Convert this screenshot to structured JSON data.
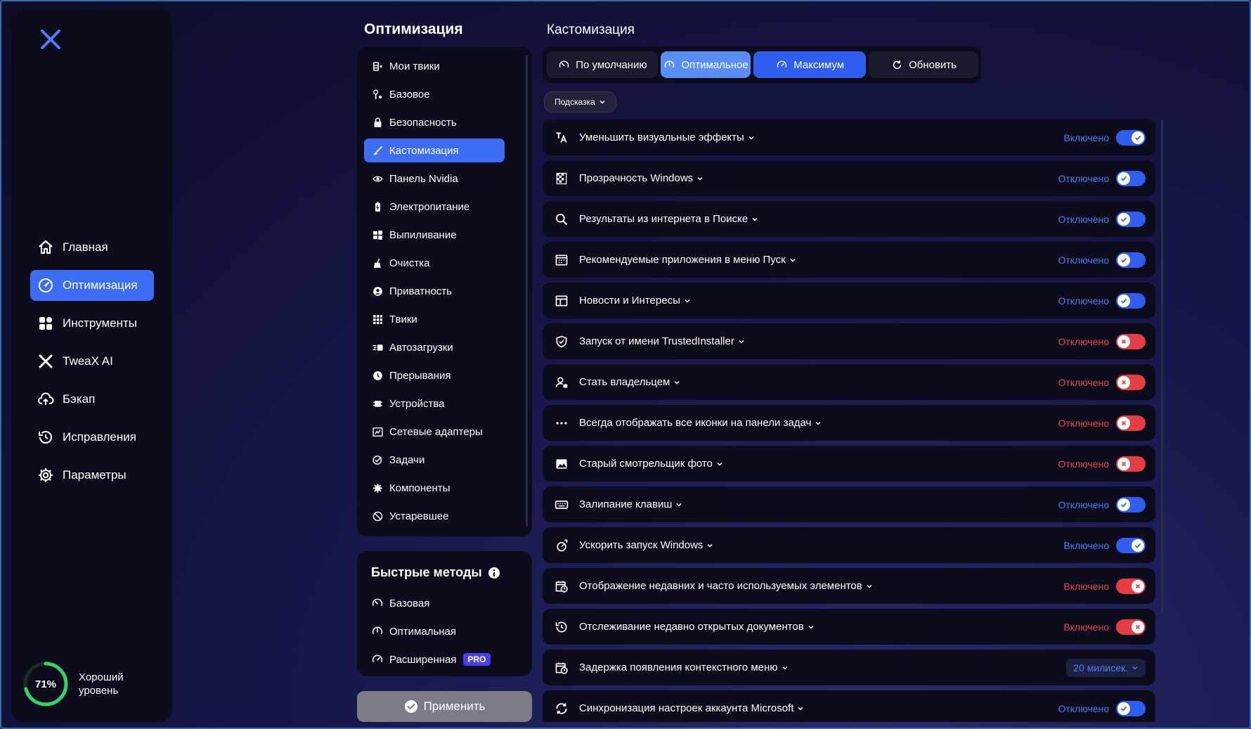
{
  "sidebar": {
    "nav": [
      {
        "label": "Главная",
        "icon": "home-icon"
      },
      {
        "label": "Оптимизация",
        "icon": "gauge-icon",
        "active": true
      },
      {
        "label": "Инструменты",
        "icon": "grid-icon"
      },
      {
        "label": "TweaX AI",
        "icon": "ai-icon"
      },
      {
        "label": "Бэкап",
        "icon": "cloud-upload-icon"
      },
      {
        "label": "Исправления",
        "icon": "history-icon"
      },
      {
        "label": "Параметры",
        "icon": "gear-icon"
      }
    ],
    "health": {
      "percent_label": "71%",
      "percent": 71,
      "label": "Хороший уровень"
    }
  },
  "middle": {
    "title": "Оптимизация",
    "categories": [
      {
        "label": "Мои твики",
        "icon": "my-tweaks-icon"
      },
      {
        "label": "Базовое",
        "icon": "tools-icon"
      },
      {
        "label": "Безопасность",
        "icon": "lock-icon"
      },
      {
        "label": "Кастомизация",
        "icon": "brush-icon",
        "active": true
      },
      {
        "label": "Панель Nvidia",
        "icon": "nvidia-icon"
      },
      {
        "label": "Электропитание",
        "icon": "battery-icon"
      },
      {
        "label": "Выпиливание",
        "icon": "windows-icon"
      },
      {
        "label": "Очистка",
        "icon": "broom-icon"
      },
      {
        "label": "Приватность",
        "icon": "privacy-icon"
      },
      {
        "label": "Твики",
        "icon": "apps-icon"
      },
      {
        "label": "Автозагрузки",
        "icon": "startup-icon"
      },
      {
        "label": "Прерывания",
        "icon": "interrupt-icon"
      },
      {
        "label": "Устройства",
        "icon": "chip-icon"
      },
      {
        "label": "Сетевые адаптеры",
        "icon": "network-icon"
      },
      {
        "label": "Задачи",
        "icon": "tasks-icon"
      },
      {
        "label": "Компоненты",
        "icon": "puzzle-icon"
      },
      {
        "label": "Устаревшее",
        "icon": "deprecated-icon"
      }
    ],
    "quick": {
      "title": "Быстрые методы",
      "items": [
        {
          "label": "Базовая",
          "icon": "speed-basic-icon"
        },
        {
          "label": "Оптимальная",
          "icon": "speed-optimal-icon"
        },
        {
          "label": "Расширенная",
          "icon": "speed-max-icon",
          "badge": "PRO"
        }
      ]
    },
    "apply_label": "Применить"
  },
  "right": {
    "title": "Кастомизация",
    "presets": [
      {
        "label": "По умолчанию",
        "icon": "speed-basic-icon",
        "style": "default"
      },
      {
        "label": "Оптимальное",
        "icon": "speed-optimal-icon",
        "style": "opt"
      },
      {
        "label": "Максимум",
        "icon": "speed-max-icon",
        "style": "max"
      },
      {
        "label": "Обновить",
        "icon": "refresh-icon",
        "style": "default"
      }
    ],
    "hint_label": "Подсказка",
    "tweaks": [
      {
        "label": "Уменьшить визуальные эффекты",
        "icon": "font-icon",
        "status": "Включено",
        "color": "blue",
        "toggle": "on-blue"
      },
      {
        "label": "Прозрачность Windows",
        "icon": "transparency-icon",
        "status": "Отключено",
        "color": "blue",
        "toggle": "off-blue"
      },
      {
        "label": "Результаты из интернета в Поиске",
        "icon": "search-icon",
        "status": "Отключено",
        "color": "blue",
        "toggle": "off-blue"
      },
      {
        "label": "Рекомендуемые приложения в меню Пуск",
        "icon": "start-menu-icon",
        "status": "Отключено",
        "color": "blue",
        "toggle": "off-blue"
      },
      {
        "label": "Новости и Интересы",
        "icon": "news-icon",
        "status": "Отключено",
        "color": "blue",
        "toggle": "off-blue"
      },
      {
        "label": "Запуск от имени TrustedInstaller",
        "icon": "shield-icon",
        "status": "Отключено",
        "color": "red",
        "toggle": "off-red"
      },
      {
        "label": "Стать владельцем",
        "icon": "user-lock-icon",
        "status": "Отключено",
        "color": "red",
        "toggle": "off-red"
      },
      {
        "label": "Всегда отображать все иконки на панели задач",
        "icon": "more-icon",
        "status": "Отключено",
        "color": "red",
        "toggle": "off-red"
      },
      {
        "label": "Старый смотрельщик фото",
        "icon": "image-icon",
        "status": "Отключено",
        "color": "red",
        "toggle": "off-red"
      },
      {
        "label": "Залипание клавиш",
        "icon": "keyboard-icon",
        "status": "Отключено",
        "color": "blue",
        "toggle": "off-blue"
      },
      {
        "label": "Ускорить запуск Windows",
        "icon": "rocket-icon",
        "status": "Включено",
        "color": "blue",
        "toggle": "on-blue"
      },
      {
        "label": "Отображение недавних и часто используемых элементов",
        "icon": "calendar-clock-icon",
        "status": "Включено",
        "color": "red",
        "toggle": "on-red"
      },
      {
        "label": "Отслеживание недавно открытых документов",
        "icon": "history-icon",
        "status": "Включено",
        "color": "red",
        "toggle": "on-red"
      },
      {
        "label": "Задержка появления контекстного меню",
        "icon": "calendar-clock-icon",
        "select": "20 милисек."
      },
      {
        "label": "Синхронизация настроек аккаунта Microsoft",
        "icon": "sync-icon",
        "status": "Отключено",
        "color": "blue",
        "toggle": "off-blue"
      }
    ]
  },
  "colors": {
    "accent": "#3d6df2",
    "accent_light": "#5a8ef7",
    "panel": "#0c0c1c",
    "status_blue": "#4f7cf8",
    "status_red": "#e9484e",
    "health_green": "#2bd66b"
  }
}
